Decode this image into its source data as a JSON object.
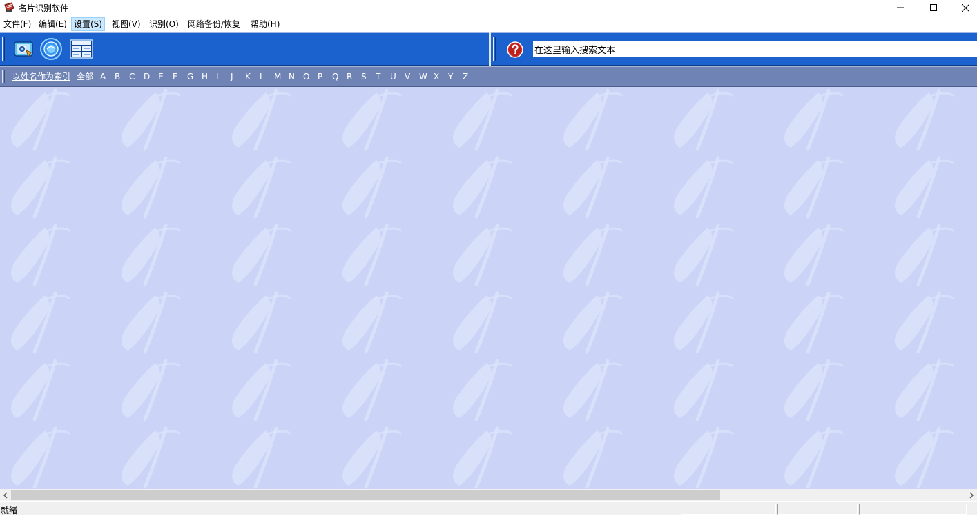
{
  "window": {
    "title": "名片识别软件",
    "controls": {
      "minimize": "—",
      "maximize": "☐",
      "close": "✕"
    }
  },
  "menu": {
    "items": [
      {
        "label": "文件(F)"
      },
      {
        "label": "编辑(E)"
      },
      {
        "label": "设置(S)"
      },
      {
        "label": "视图(V)"
      },
      {
        "label": "识别(O)"
      },
      {
        "label": "网络备份/恢复"
      },
      {
        "label": "帮助(H)"
      }
    ],
    "highlighted": "设置(S)"
  },
  "toolbar": {
    "icons": [
      "scan-card-icon",
      "globe-icon",
      "card-layout-icon"
    ],
    "help_icon": "help-icon",
    "search_value": "在这里输入搜索文本"
  },
  "index_bar": {
    "by_name_label": "以姓名作为索引",
    "all_label": "全部",
    "letters": [
      "A",
      "B",
      "C",
      "D",
      "E",
      "F",
      "G",
      "H",
      "I",
      "J",
      "K",
      "L",
      "M",
      "N",
      "O",
      "P",
      "Q",
      "R",
      "S",
      "T",
      "U",
      "V",
      "W",
      "X",
      "Y",
      "Z"
    ]
  },
  "status": {
    "text": "就绪"
  },
  "colors": {
    "toolbar_blue": "#1c62cf",
    "index_bar": "#6f84b4",
    "main_background": "#cbd4f6"
  }
}
